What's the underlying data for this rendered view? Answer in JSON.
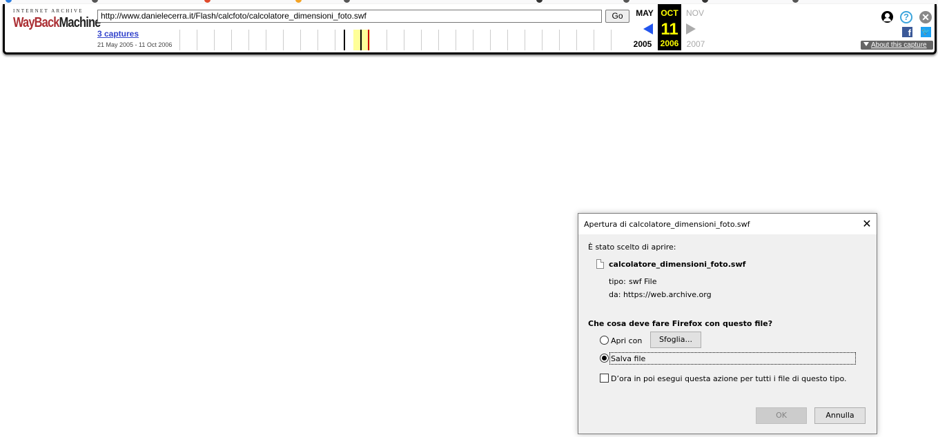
{
  "wayback": {
    "logo_top": "INTERNET ARCHIVE",
    "logo_way": "WayBack",
    "logo_machine": "Machine",
    "url": "http://www.danielecerra.it/Flash/calcfoto/calcolatore_dimensioni_foto.swf",
    "go_label": "Go",
    "captures_label": "3 captures",
    "captures_range": "21 May 2005 - 11 Oct 2006",
    "prev_month": "MAY",
    "current_month": "OCT",
    "current_day": "11",
    "current_year": "2006",
    "next_month": "NOV",
    "prev_year": "2005",
    "next_year": "2007",
    "about_label": "About this capture",
    "colors": {
      "current_highlight": "#ffff00",
      "prev_arrow": "#2255ee",
      "logo_red": "#ab2e33"
    }
  },
  "dialog": {
    "title": "Apertura di calcolatore_dimensioni_foto.swf",
    "intro": "È stato scelto di aprire:",
    "file_name": "calcolatore_dimensioni_foto.swf",
    "type_label": "tipo:",
    "type_value": "swf File",
    "from_label": "da:",
    "from_value": "https://web.archive.org",
    "question": "Che cosa deve fare Firefox con questo file?",
    "open_with_label": "Apri con",
    "browse_label": "Sfoglia...",
    "save_label": "Salva file",
    "remember_label": "D’ora in poi esegui questa azione per tutti i file di questo tipo.",
    "ok_label": "OK",
    "cancel_label": "Annulla",
    "selected_option": "Salva file",
    "remember_checked": false,
    "ok_enabled": false
  }
}
